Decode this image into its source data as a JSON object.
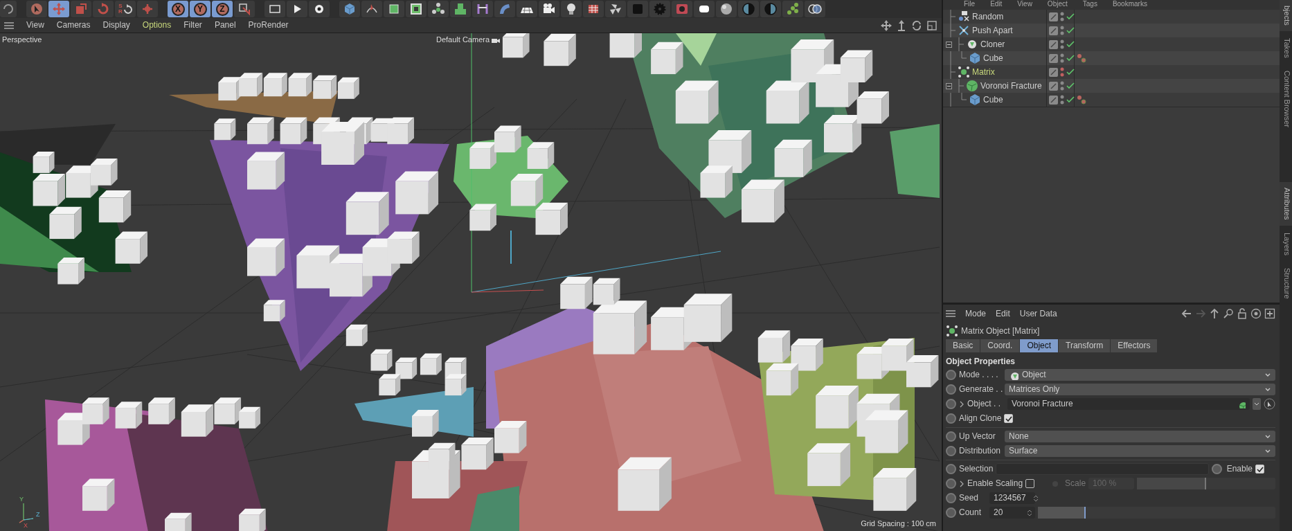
{
  "toolbar": {
    "modeling_tools": [
      {
        "kind": "select",
        "selected": false
      },
      {
        "kind": "move",
        "selected": true
      },
      {
        "kind": "scale",
        "selected": false
      },
      {
        "kind": "rotate",
        "selected": false
      },
      {
        "kind": "recent",
        "selected": false,
        "letters": [
          "S",
          "R"
        ]
      },
      {
        "kind": "transform",
        "selected": false
      }
    ],
    "axis_buttons": [
      {
        "label": "X",
        "selected": true
      },
      {
        "label": "Y",
        "selected": true
      },
      {
        "label": "Z",
        "selected": true
      }
    ]
  },
  "viewport": {
    "menu": [
      {
        "label": "View",
        "highlighted": false
      },
      {
        "label": "Cameras",
        "highlighted": false
      },
      {
        "label": "Display",
        "highlighted": false
      },
      {
        "label": "Options",
        "highlighted": true
      },
      {
        "label": "Filter",
        "highlighted": false
      },
      {
        "label": "Panel",
        "highlighted": false
      },
      {
        "label": "ProRender",
        "highlighted": false
      }
    ],
    "view_name": "Perspective",
    "camera": "Default Camera",
    "grid_spacing": "Grid Spacing : 100 cm",
    "axis_labels": [
      "Y",
      "Z",
      "X"
    ]
  },
  "object_manager": {
    "menu": [
      "File",
      "Edit",
      "View",
      "Object",
      "Tags",
      "Bookmarks"
    ],
    "objects": [
      {
        "name": "Random",
        "kind": "random_effector",
        "selected": false,
        "hidden": false
      },
      {
        "name": "Push Apart",
        "kind": "push_apart_effector",
        "selected": false,
        "hidden": false
      },
      {
        "name": "Cloner",
        "kind": "cloner",
        "selected": false,
        "hidden": false,
        "expanded": true,
        "children": [
          {
            "name": "Cube",
            "kind": "cube",
            "selected": false,
            "hidden": false,
            "tagged": true
          }
        ]
      },
      {
        "name": "Matrix",
        "kind": "matrix",
        "selected": true,
        "hidden": true
      },
      {
        "name": "Voronoi Fracture",
        "kind": "voronoi_fracture",
        "selected": false,
        "hidden": false,
        "expanded": true,
        "children": [
          {
            "name": "Cube",
            "kind": "cube",
            "selected": false,
            "hidden": false,
            "tagged": true
          }
        ]
      }
    ]
  },
  "attributes": {
    "menu": [
      "Mode",
      "Edit",
      "User Data"
    ],
    "title": "Matrix Object [Matrix]",
    "tabs": [
      {
        "label": "Basic",
        "selected": false
      },
      {
        "label": "Coord.",
        "selected": false
      },
      {
        "label": "Object",
        "selected": true
      },
      {
        "label": "Transform",
        "selected": false
      },
      {
        "label": "Effectors",
        "selected": false
      }
    ],
    "section": "Object Properties",
    "params": [
      {
        "kind": "dropdown",
        "label": "Mode . . . .",
        "value": "Object",
        "value_icon": true
      },
      {
        "kind": "dropdown",
        "label": "Generate . .",
        "value": "Matrices Only"
      },
      {
        "kind": "link",
        "label": "Object . .",
        "value": "Voronoi Fracture",
        "expandable": true
      },
      {
        "kind": "checkbox",
        "label": "Align Clone",
        "checked": true
      },
      {
        "kind": "dropdown",
        "label": "Up Vector",
        "value": "None",
        "divider_before": true
      },
      {
        "kind": "dropdown",
        "label": "Distribution",
        "value": "Surface"
      },
      {
        "kind": "selection",
        "label": "Selection",
        "enable_label": "Enable",
        "checked": true,
        "divider_before": true
      },
      {
        "kind": "scaling",
        "label": "Enable Scaling",
        "checked": false,
        "expandable": true,
        "scale_label": "Scale",
        "scale_value": "100 %",
        "disabled": true,
        "level": 0.5
      },
      {
        "kind": "number",
        "label": "Seed",
        "value": "1234567"
      },
      {
        "kind": "slider",
        "label": "Count",
        "value": "20",
        "level": 0.2
      }
    ]
  },
  "side_tabs": [
    {
      "label": "bjects",
      "selected": true
    },
    {
      "label": "Takes",
      "selected": false
    },
    {
      "label": "Content Browser",
      "selected": false
    },
    {
      "label": "Attributes",
      "selected": true
    },
    {
      "label": "Layers",
      "selected": false
    },
    {
      "label": "Structure",
      "selected": false
    }
  ]
}
